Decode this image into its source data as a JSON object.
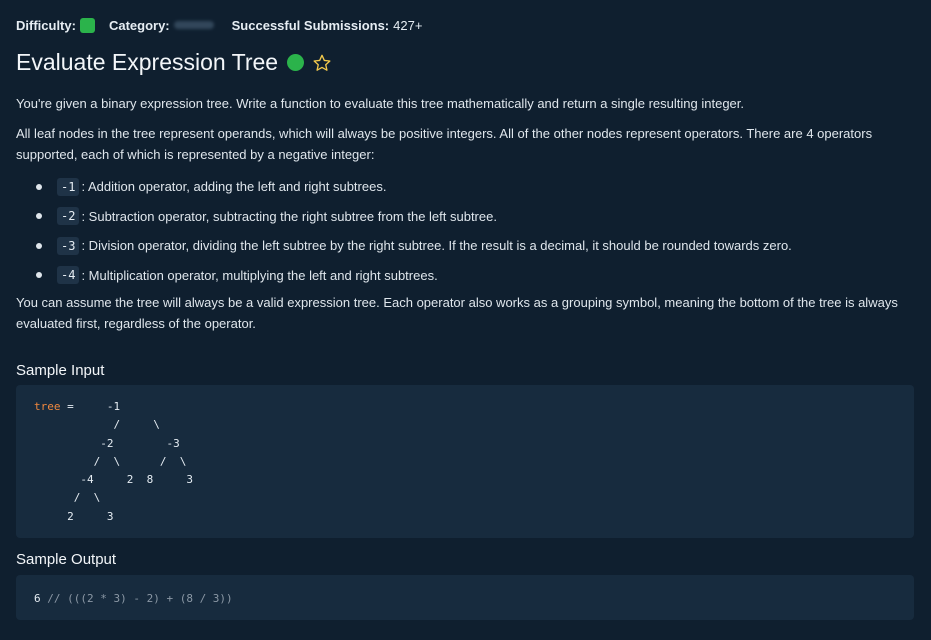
{
  "meta": {
    "difficulty_label": "Difficulty:",
    "category_label": "Category:",
    "submissions_label": "Successful Submissions:",
    "submissions_value": "427+"
  },
  "title": "Evaluate Expression Tree",
  "description": {
    "p1": "You're given a binary expression tree. Write a function to evaluate this tree mathematically and return a single resulting integer.",
    "p2": "All leaf nodes in the tree represent operands, which will always be positive integers. All of the other nodes represent operators. There are 4 operators supported, each of which is represented by a negative integer:",
    "operators": [
      {
        "code": "-1",
        "text": ": Addition operator, adding the left and right subtrees."
      },
      {
        "code": "-2",
        "text": ": Subtraction operator, subtracting the right subtree from the left subtree."
      },
      {
        "code": "-3",
        "text": ": Division operator, dividing the left subtree by the right subtree. If the result is a decimal, it should be rounded towards zero."
      },
      {
        "code": "-4",
        "text": ": Multiplication operator, multiplying the left and right subtrees."
      }
    ],
    "p3": "You can assume the tree will always be a valid expression tree. Each operator also works as a grouping symbol, meaning the bottom of the tree is always evaluated first, regardless of the operator."
  },
  "sample_input": {
    "heading": "Sample Input",
    "var_name": "tree",
    "code_rest": " =     -1\n            /     \\\n          -2        -3\n         /  \\      /  \\\n       -4     2  8     3\n      /  \\\n     2     3"
  },
  "sample_output": {
    "heading": "Sample Output",
    "value": "6",
    "comment": " // (((2 * 3) - 2) + (8 / 3))"
  },
  "colors": {
    "background": "#0f1f2f",
    "code_background": "#172b3e",
    "easy_green": "#2bb34b",
    "star_yellow": "#f2c94c",
    "keyword_orange": "#f0883e"
  }
}
